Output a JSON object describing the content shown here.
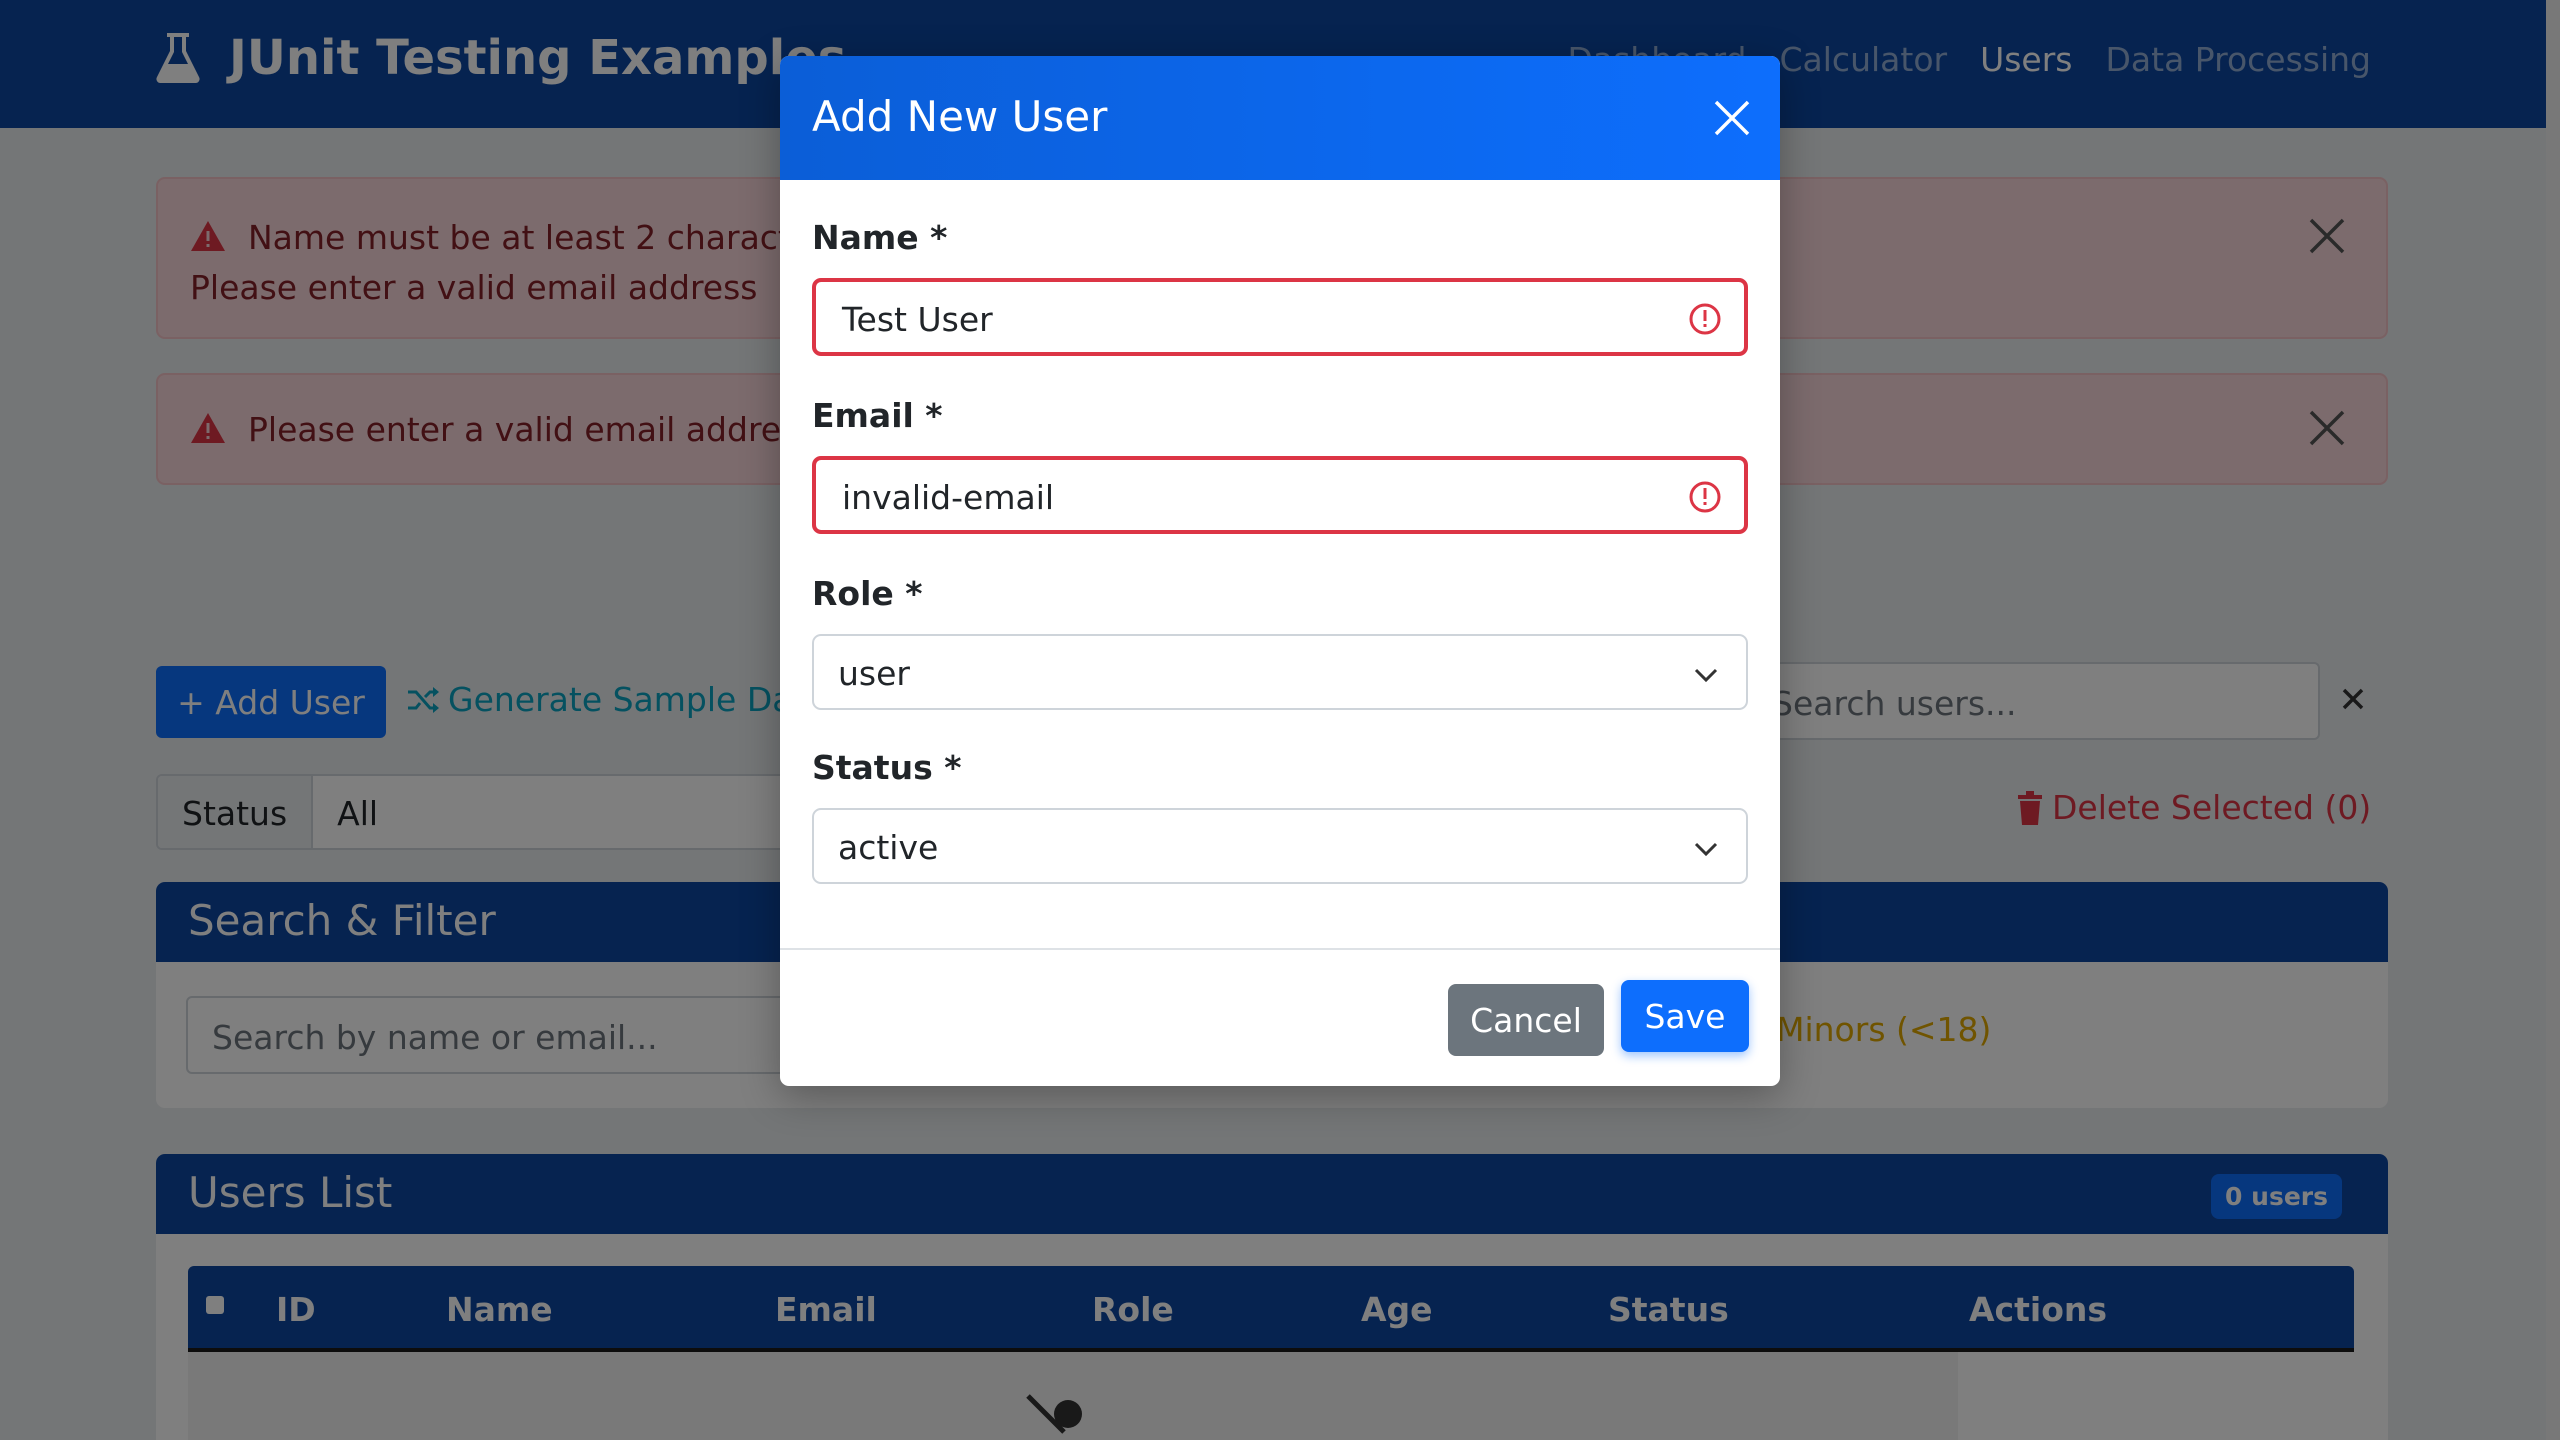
{
  "navbar": {
    "brand": "JUnit Testing Examples",
    "links": [
      "Dashboard",
      "Calculator",
      "Users",
      "Data Processing"
    ],
    "active": "Users"
  },
  "alerts": {
    "first_line1": "Name must be at least 2 characters",
    "first_line2": "Please enter a valid email address",
    "second": "Please enter a valid email address"
  },
  "toolbar": {
    "add_user": "+ Add User",
    "generate": "Generate Sample Data",
    "search_placeholder": "Search users...",
    "status_label": "Status",
    "status_value": "All",
    "delete_selected": "Delete Selected (0)"
  },
  "search_card": {
    "title": "Search & Filter",
    "search_placeholder": "Search by name or email...",
    "minors": "Minors (<18)"
  },
  "users_card": {
    "title": "Users List",
    "badge": "0 users",
    "columns": [
      "ID",
      "Name",
      "Email",
      "Role",
      "Age",
      "Status",
      "Actions"
    ]
  },
  "modal": {
    "title": "Add New User",
    "name_label": "Name *",
    "name_value": "Test User",
    "email_label": "Email *",
    "email_value": "invalid-email",
    "role_label": "Role *",
    "role_value": "user",
    "status_label": "Status *",
    "status_value": "active",
    "cancel": "Cancel",
    "save": "Save"
  },
  "colors": {
    "navbar": "#0d47a1",
    "primary": "#0d6efd",
    "danger": "#dc3545",
    "secondary": "#6c757d",
    "info": "#0aa2c0",
    "warning": "#e0a800"
  }
}
